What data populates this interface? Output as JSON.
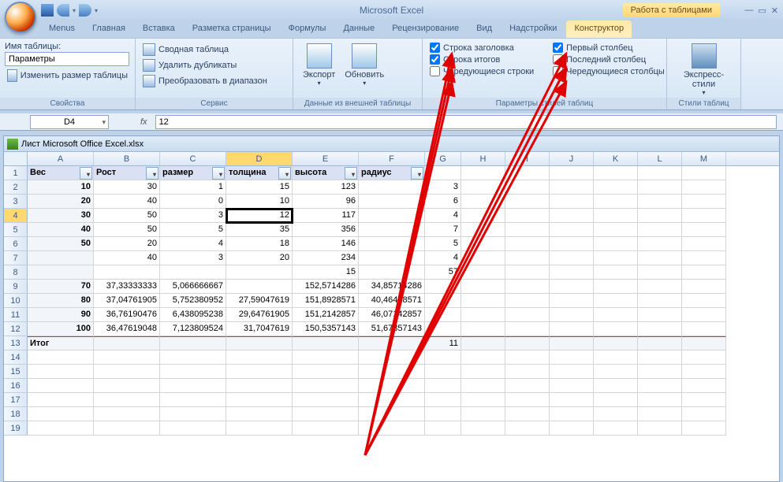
{
  "app": {
    "title": "Microsoft Excel",
    "tools_context": "Работа с таблицами"
  },
  "qat": {
    "save": "save-icon",
    "undo": "undo-icon",
    "redo": "redo-icon"
  },
  "tabs": [
    "Menus",
    "Главная",
    "Вставка",
    "Разметка страницы",
    "Формулы",
    "Данные",
    "Рецензирование",
    "Вид",
    "Надстройки",
    "Конструктор"
  ],
  "ribbon": {
    "props": {
      "name_label": "Имя таблицы:",
      "table_name": "Параметры",
      "resize": "Изменить размер таблицы",
      "group": "Свойства"
    },
    "tools": {
      "pivot": "Сводная таблица",
      "dedupe": "Удалить дубликаты",
      "range": "Преобразовать в диапазон",
      "group": "Сервис"
    },
    "ext": {
      "export": "Экспорт",
      "refresh": "Обновить",
      "group": "Данные из внешней таблицы"
    },
    "styleopts": {
      "header_row": "Строка заголовка",
      "total_row": "Строка итогов",
      "banded_rows": "Чередующиеся строки",
      "first_col": "Первый столбец",
      "last_col": "Последний столбец",
      "banded_cols": "Чередующиеся столбцы",
      "group": "Параметры стилей таблиц"
    },
    "styles": {
      "express": "Экспресс-стили",
      "group": "Стили таблиц"
    }
  },
  "formula": {
    "cell_ref": "D4",
    "fx": "fx",
    "value": "12"
  },
  "workbook": {
    "title": "Лист Microsoft Office Excel.xlsx"
  },
  "columns": [
    "A",
    "B",
    "C",
    "D",
    "E",
    "F",
    "G",
    "H",
    "I",
    "J",
    "K",
    "L",
    "M"
  ],
  "chart_data": {
    "type": "table",
    "headers": [
      "Вес",
      "Рост",
      "размер",
      "толщина",
      "высота",
      "радиус",
      ""
    ],
    "rows": [
      [
        "10",
        "30",
        "1",
        "15",
        "123",
        "",
        "3"
      ],
      [
        "20",
        "40",
        "0",
        "10",
        "96",
        "",
        "6"
      ],
      [
        "30",
        "50",
        "3",
        "12",
        "117",
        "",
        "4"
      ],
      [
        "40",
        "50",
        "5",
        "35",
        "356",
        "",
        "7"
      ],
      [
        "50",
        "20",
        "4",
        "18",
        "146",
        "",
        "5"
      ],
      [
        "",
        "40",
        "3",
        "20",
        "234",
        "",
        "4"
      ],
      [
        "",
        "",
        "",
        "",
        "15",
        "",
        "57"
      ],
      [
        "70",
        "37,33333333",
        "5,066666667",
        "",
        "152,5714286",
        "34,85714286",
        ""
      ],
      [
        "80",
        "37,04761905",
        "5,752380952",
        "27,59047619",
        "151,8928571",
        "40,46428571",
        ""
      ],
      [
        "90",
        "36,76190476",
        "6,438095238",
        "29,64761905",
        "151,2142857",
        "46,07142857",
        ""
      ],
      [
        "100",
        "36,47619048",
        "7,123809524",
        "31,7047619",
        "150,5357143",
        "51,67857143",
        ""
      ]
    ],
    "total_label": "Итог",
    "total_value": "11"
  }
}
